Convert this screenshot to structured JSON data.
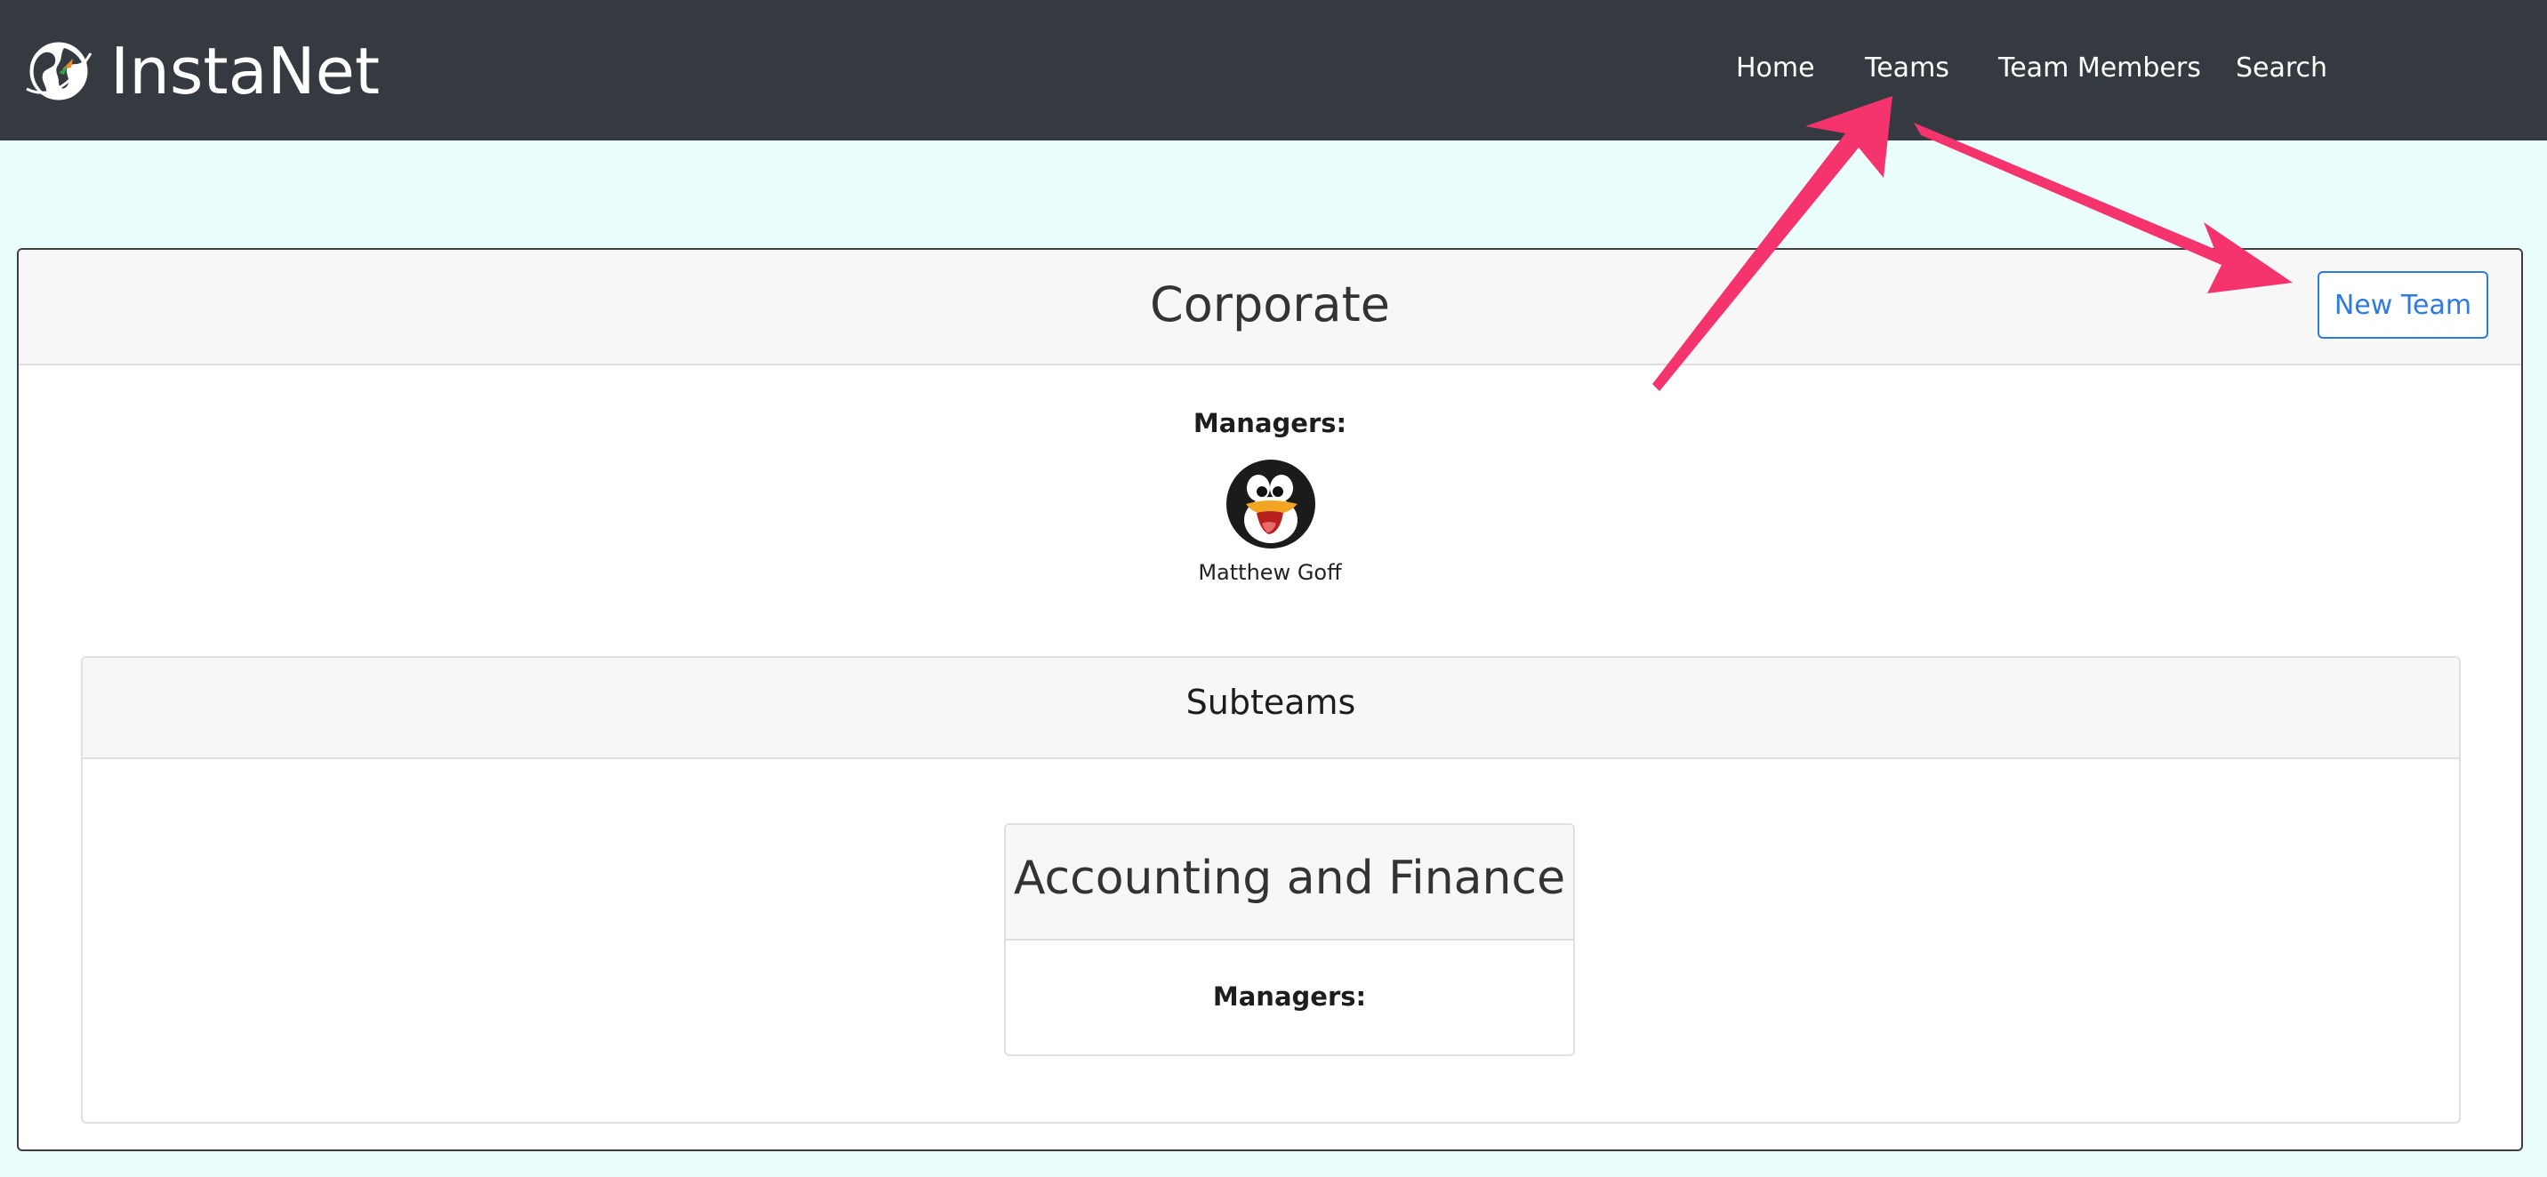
{
  "app": {
    "brand_name": "InstaNet",
    "logo_icon": "globe-icon"
  },
  "nav": {
    "items": [
      {
        "label": "Home"
      },
      {
        "label": "Teams"
      },
      {
        "label": "Team Members"
      },
      {
        "label": "Search"
      }
    ]
  },
  "team": {
    "name": "Corporate",
    "new_team_label": "New Team",
    "managers_label": "Managers:",
    "managers": [
      {
        "name": "Matthew Goff",
        "avatar_icon": "penguin-avatar"
      }
    ]
  },
  "subteams": {
    "title": "Subteams",
    "items": [
      {
        "name": "Accounting and Finance",
        "managers_label": "Managers:"
      }
    ]
  },
  "annotations": {
    "arrow_color": "#f5346e"
  },
  "colors": {
    "navbar_bg": "#343a40",
    "page_bg": "#eafdfd",
    "accent": "#2d7be0"
  }
}
